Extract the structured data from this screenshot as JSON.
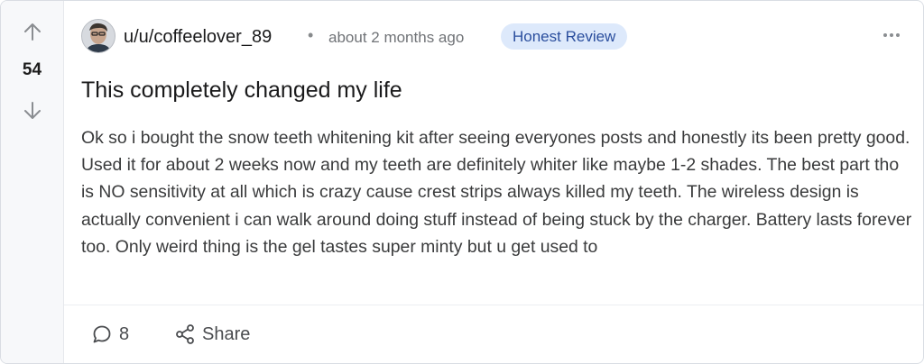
{
  "post": {
    "votes": "54",
    "username": "u/u/coffeelover_89",
    "separator": "•",
    "timestamp": "about 2 months ago",
    "flair": "Honest Review",
    "title": "This completely changed my life",
    "body": "Ok so i bought the snow teeth whitening kit after seeing everyones posts and honestly its been pretty good. Used it for about 2 weeks now and my teeth are definitely whiter like maybe 1-2 shades. The best part tho is NO sensitivity at all which is crazy cause crest strips always killed my teeth. The wireless design is actually convenient i can walk around doing stuff instead of being stuck by the charger. Battery lasts forever too. Only weird thing is the gel tastes super minty but u get used to"
  },
  "actions": {
    "comment_count": "8",
    "share_label": "Share"
  },
  "icons": {
    "upvote": "arrow-up-icon",
    "downvote": "arrow-down-icon",
    "more": "more-horizontal-icon",
    "comment": "speech-bubble-icon",
    "share": "share-nodes-icon"
  },
  "colors": {
    "flair_bg": "#dde9fb",
    "flair_text": "#2b4f9e",
    "vote_bar_bg": "#f7f8fa"
  }
}
